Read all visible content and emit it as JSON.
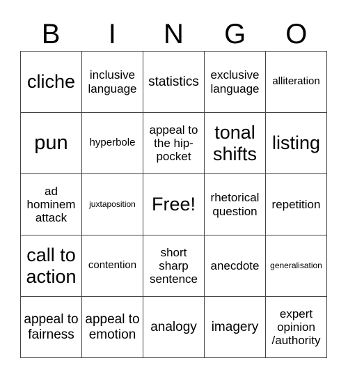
{
  "header": {
    "letters": [
      "B",
      "I",
      "N",
      "G",
      "O"
    ]
  },
  "cells": [
    {
      "text": "cliche",
      "size": "s-l"
    },
    {
      "text": "inclusive language",
      "size": "s-s"
    },
    {
      "text": "statistics",
      "size": "s-m"
    },
    {
      "text": "exclusive language",
      "size": "s-s"
    },
    {
      "text": "alliteration",
      "size": "s-xs"
    },
    {
      "text": "pun",
      "size": "s-xl"
    },
    {
      "text": "hyperbole",
      "size": "s-xs"
    },
    {
      "text": "appeal to the hip-pocket",
      "size": "s-s"
    },
    {
      "text": "tonal shifts",
      "size": "s-l"
    },
    {
      "text": "listing",
      "size": "s-l"
    },
    {
      "text": "ad hominem attack",
      "size": "s-s"
    },
    {
      "text": "juxtaposition",
      "size": "s-xxs"
    },
    {
      "text": "Free!",
      "size": "s-l"
    },
    {
      "text": "rhetorical question",
      "size": "s-s"
    },
    {
      "text": "repetition",
      "size": "s-s"
    },
    {
      "text": "call to action",
      "size": "s-l"
    },
    {
      "text": "contention",
      "size": "s-xs"
    },
    {
      "text": "short sharp sentence",
      "size": "s-s"
    },
    {
      "text": "anecdote",
      "size": "s-s"
    },
    {
      "text": "generalisation",
      "size": "s-xxs"
    },
    {
      "text": "appeal to fairness",
      "size": "s-m"
    },
    {
      "text": "appeal to emotion",
      "size": "s-m"
    },
    {
      "text": "analogy",
      "size": "s-m"
    },
    {
      "text": "imagery",
      "size": "s-m"
    },
    {
      "text": "expert opinion /authority",
      "size": "s-s"
    }
  ]
}
